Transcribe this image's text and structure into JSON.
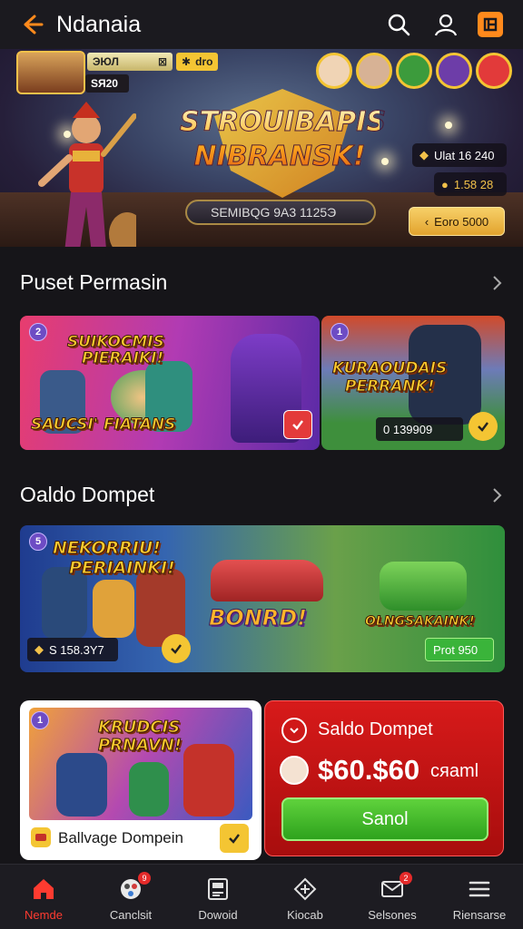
{
  "header": {
    "title": "Ndanaia",
    "icons": [
      "back-arrow-icon",
      "search-icon",
      "user-icon",
      "app-logo-icon"
    ]
  },
  "hero": {
    "player_tag": "ЭЮЛ",
    "player_tag_suffix": "⊠",
    "player_score": "SЯ20",
    "chip_label": "dro",
    "title_line1": "STROUIBAPIS",
    "title_line2": "NIBRANSK!",
    "bar_text": "SEMIBQG 9A3 1125Э",
    "stat_a": "Ulat 16 240",
    "stat_b": "1.58 28",
    "button_label": "Eoro 5000"
  },
  "section1": {
    "title": "Puset Permasin",
    "cards": [
      {
        "badge": "2",
        "title_line1": "SUIKOCMIS",
        "title_line2": "PIERAIKI!",
        "subtitle": "SAUCSI' FIATANS"
      },
      {
        "badge": "1",
        "title_line1": "KURAOUDAIS",
        "title_line2": "PERRANK!",
        "pill": "0 139909"
      }
    ]
  },
  "section2": {
    "title": "Oaldo Dompet",
    "banner": {
      "badge": "5",
      "title_line1": "NEKORRIU!",
      "title_line2": "PERIAINKI!",
      "middle": "BONRD!",
      "right": "OLNGSAKAINK!",
      "pill_left": "S 158.3Y7",
      "pill_right": "Prot 950"
    }
  },
  "tile": {
    "badge": "1",
    "title_line1": "KRUDCIS",
    "title_line2": "PRNAVN!",
    "label": "Ballvage Dompein"
  },
  "saldo": {
    "title": "Saldo Dompet",
    "amount": "$60.$60",
    "unit": "cяaml",
    "button": "Sanol"
  },
  "nav": {
    "items": [
      {
        "label": "Nemde",
        "icon": "home-icon",
        "badge": ""
      },
      {
        "label": "Canclsit",
        "icon": "games-icon",
        "badge": "9"
      },
      {
        "label": "Dowoid",
        "icon": "download-icon",
        "badge": ""
      },
      {
        "label": "Kiocab",
        "icon": "clubs-icon",
        "badge": ""
      },
      {
        "label": "Selsones",
        "icon": "messages-icon",
        "badge": "2"
      },
      {
        "label": "Riensarse",
        "icon": "menu-icon",
        "badge": ""
      }
    ]
  },
  "colors": {
    "accent": "#ff8a1c",
    "active_nav": "#ff3b30",
    "saldo_red": "#d71a1a",
    "send_green": "#3fbf2a"
  }
}
